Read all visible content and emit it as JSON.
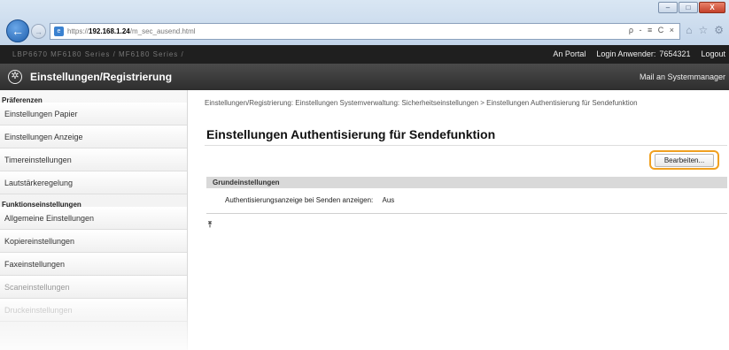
{
  "browser": {
    "window_controls": [
      "–",
      "□",
      "X"
    ],
    "url_prefix": "https://",
    "url_host": "192.168.1.24",
    "url_path": "/m_sec_ausend.html",
    "address_tools": "ρ - ≡ C ×",
    "toolbar_icons": [
      "⌂",
      "☆",
      "⚙"
    ]
  },
  "topbar": {
    "model": "LBP6670    MF6180 Series / MF6180 Series /",
    "portal_link": "An Portal",
    "login_label": "Login Anwender:",
    "user_id": "7654321",
    "logout_link": "Logout"
  },
  "header": {
    "title": "Einstellungen/Registrierung",
    "mail_link": "Mail an Systemmanager"
  },
  "sidebar": {
    "heading_prefs": "Präferenzen",
    "prefs_items": [
      "Einstellungen Papier",
      "Einstellungen Anzeige",
      "Timereinstellungen",
      "Lautstärkeregelung"
    ],
    "heading_functions": "Funktionseinstellungen",
    "function_items": [
      "Allgemeine Einstellungen",
      "Kopiereinstellungen",
      "Faxeinstellungen",
      "Scaneinstellungen",
      "Druckeinstellungen"
    ]
  },
  "main": {
    "breadcrumb": "Einstellungen/Registrierung: Einstellungen Systemverwaltung: Sicherheitseinstellungen > Einstellungen Authentisierung für Sendefunktion",
    "page_title": "Einstellungen Authentisierung für Sendefunktion",
    "edit_button": "Bearbeiten...",
    "section_title": "Grundeinstellungen",
    "setting_label": "Authentisierungsanzeige bei Senden anzeigen:",
    "setting_value": "Aus",
    "to_top_icon": "⤒"
  },
  "colors": {
    "accent_highlight": "#f0a020",
    "topbar_bg": "#1f1f1f",
    "header_bg": "#3a3a3a"
  }
}
